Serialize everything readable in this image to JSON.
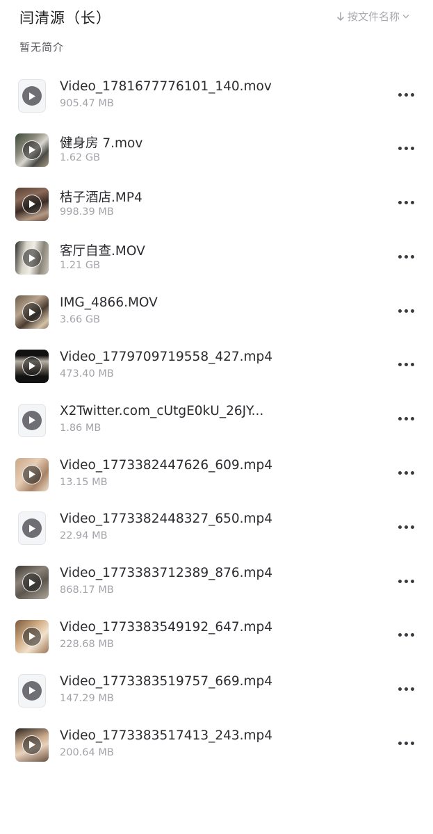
{
  "header": {
    "title": "闫清源（长）",
    "sort_label": "按文件名称",
    "sort_direction_icon": "arrow-down-icon",
    "sort_dropdown_icon": "chevron-down-icon",
    "description": "暂无简介"
  },
  "files": [
    {
      "name": "Video_1781677776101_140.mov",
      "size": "905.47 MB",
      "thumbnail": "plain"
    },
    {
      "name": "健身房 7.mov",
      "size": "1.62 GB",
      "thumbnail": "photo"
    },
    {
      "name": "桔子酒店.MP4",
      "size": "998.39 MB",
      "thumbnail": "photo"
    },
    {
      "name": "客厅自查.MOV",
      "size": "1.21 GB",
      "thumbnail": "photo"
    },
    {
      "name": "IMG_4866.MOV",
      "size": "3.66 GB",
      "thumbnail": "photo"
    },
    {
      "name": "Video_1779709719558_427.mp4",
      "size": "473.40 MB",
      "thumbnail": "photo"
    },
    {
      "name": "X2Twitter.com_cUtgE0kU_26JY...",
      "size": "1.86 MB",
      "thumbnail": "plain"
    },
    {
      "name": "Video_1773382447626_609.mp4",
      "size": "13.15 MB",
      "thumbnail": "photo"
    },
    {
      "name": "Video_1773382448327_650.mp4",
      "size": "22.94 MB",
      "thumbnail": "plain"
    },
    {
      "name": "Video_1773383712389_876.mp4",
      "size": "868.17 MB",
      "thumbnail": "photo"
    },
    {
      "name": "Video_1773383549192_647.mp4",
      "size": "228.68 MB",
      "thumbnail": "photo"
    },
    {
      "name": "Video_1773383519757_669.mp4",
      "size": "147.29 MB",
      "thumbnail": "plain"
    },
    {
      "name": "Video_1773383517413_243.mp4",
      "size": "200.64 MB",
      "thumbnail": "photo"
    }
  ],
  "icons": {
    "play": "play-icon",
    "more": "more-icon"
  },
  "colors": {
    "title": "#1a1a1a",
    "muted": "#a3a4aa",
    "play_plain": "#6e6e74",
    "more_dots": "#3a3a40"
  }
}
